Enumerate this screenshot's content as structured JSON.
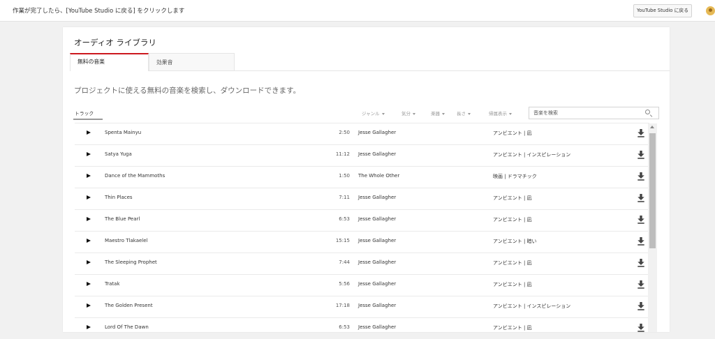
{
  "topbar": {
    "message": "作業が完了したら、[YouTube Studio に戻る] をクリックします",
    "back_button": "YouTube Studio に戻る"
  },
  "library": {
    "title": "オーディオ ライブラリ",
    "tabs": [
      {
        "label": "無料の音楽",
        "active": true
      },
      {
        "label": "効果音",
        "active": false
      }
    ],
    "intro": "プロジェクトに使える無料の音楽を検索し、ダウンロードできます。",
    "track_column": "トラック",
    "filters": [
      "ジャンル",
      "気分",
      "楽器",
      "長さ",
      "帰属表示"
    ],
    "search_placeholder": "音楽を検索"
  },
  "tracks": [
    {
      "title": "Spenta Mainyu",
      "duration": "2:50",
      "artist": "Jesse Gallagher",
      "genre": "アンビエント | 凪"
    },
    {
      "title": "Satya Yuga",
      "duration": "11:12",
      "artist": "Jesse Gallagher",
      "genre": "アンビエント | インスピレーション"
    },
    {
      "title": "Dance of the Mammoths",
      "duration": "1:50",
      "artist": "The Whole Other",
      "genre": "映画 | ドラマチック"
    },
    {
      "title": "Thin Places",
      "duration": "7:11",
      "artist": "Jesse Gallagher",
      "genre": "アンビエント | 凪"
    },
    {
      "title": "The Blue Pearl",
      "duration": "6:53",
      "artist": "Jesse Gallagher",
      "genre": "アンビエント | 凪"
    },
    {
      "title": "Maestro Tlakaelel",
      "duration": "15:15",
      "artist": "Jesse Gallagher",
      "genre": "アンビエント | 暗い"
    },
    {
      "title": "The Sleeping Prophet",
      "duration": "7:44",
      "artist": "Jesse Gallagher",
      "genre": "アンビエント | 凪"
    },
    {
      "title": "Tratak",
      "duration": "5:56",
      "artist": "Jesse Gallagher",
      "genre": "アンビエント | 凪"
    },
    {
      "title": "The Golden Present",
      "duration": "17:18",
      "artist": "Jesse Gallagher",
      "genre": "アンビエント | インスピレーション"
    },
    {
      "title": "Lord Of The Dawn",
      "duration": "6:53",
      "artist": "Jesse Gallagher",
      "genre": "アンビエント | 凪"
    }
  ],
  "colors": {
    "accent": "#cc181e",
    "background": "#f1f1f1"
  }
}
